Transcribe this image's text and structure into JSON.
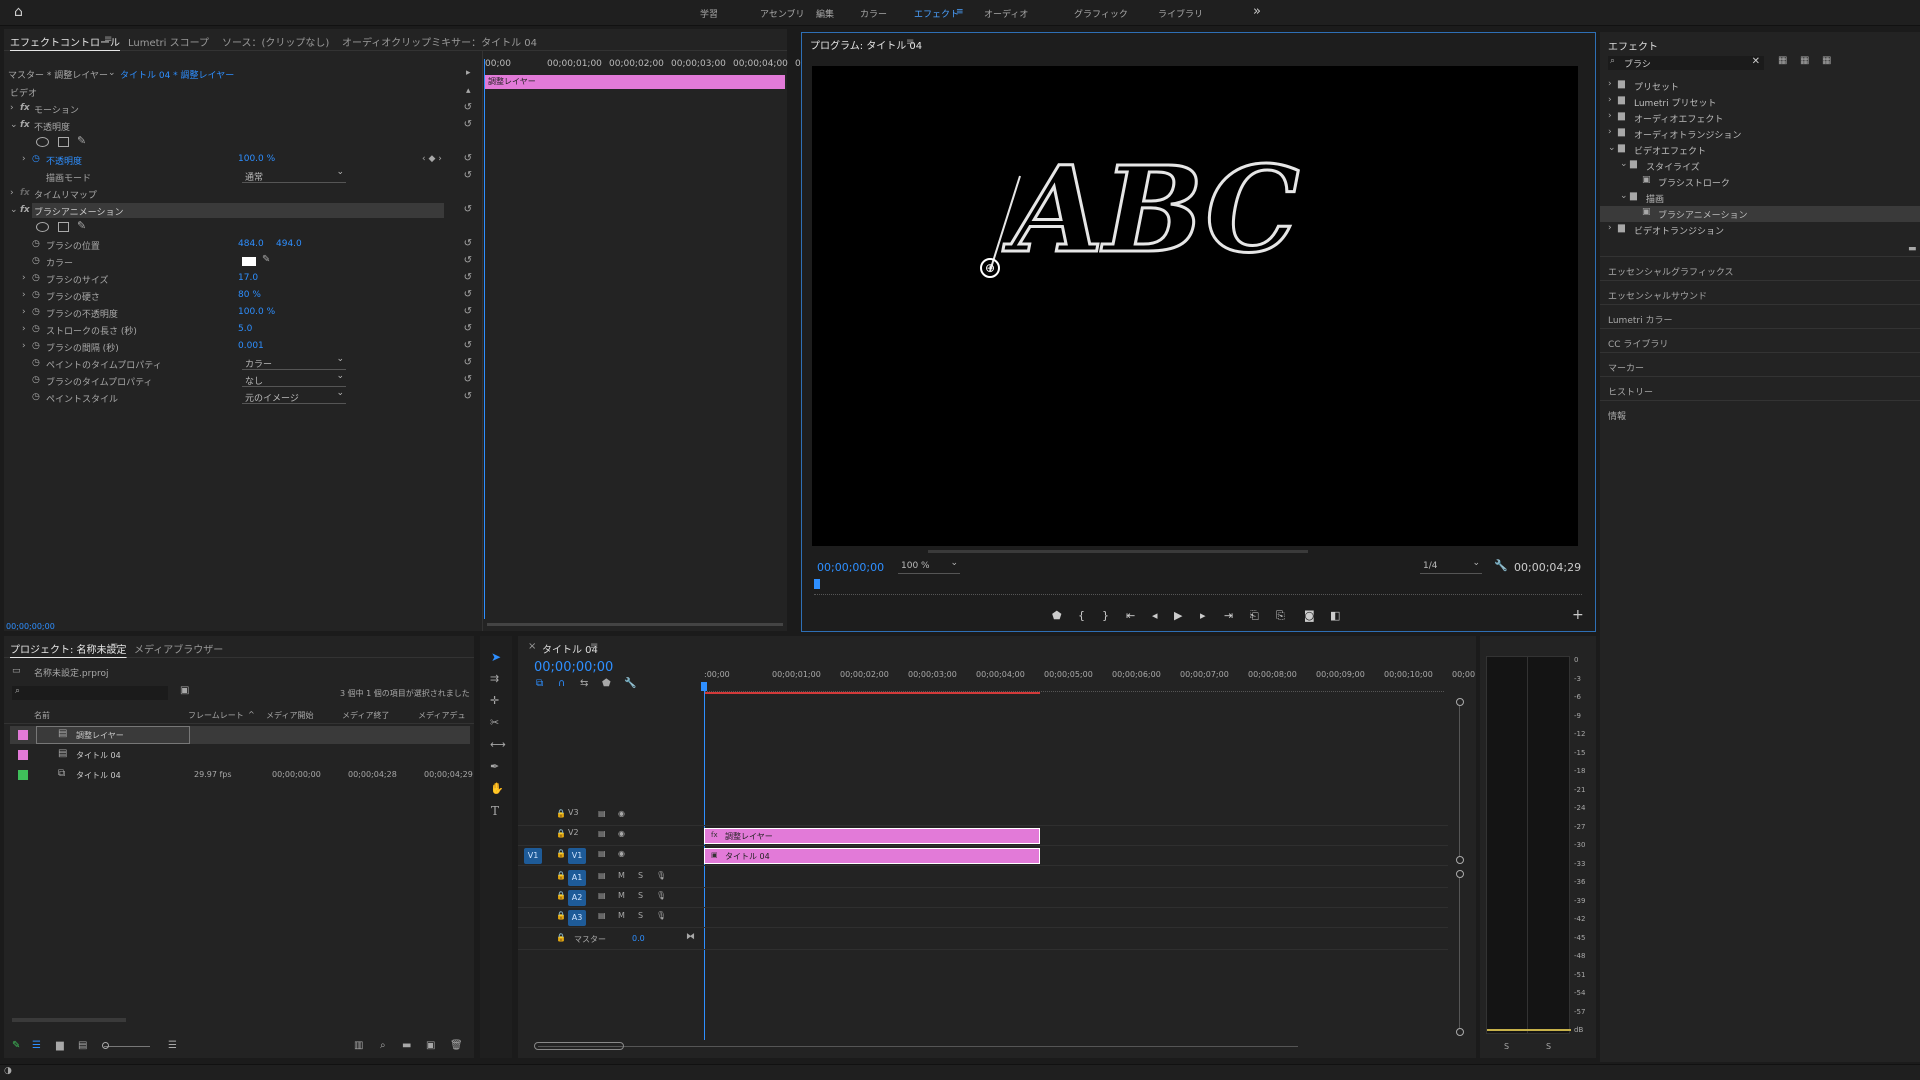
{
  "workspaces": {
    "items": [
      "学習",
      "アセンブリ",
      "編集",
      "カラー",
      "エフェクト",
      "オーディオ",
      "グラフィック",
      "ライブラリ"
    ],
    "active": "エフェクト",
    "overflow": "»"
  },
  "effect_controls": {
    "tabs": [
      "エフェクトコントロール",
      "Lumetri スコープ",
      "ソース：(クリップなし)",
      "オーディオクリップミキサー：タイトル 04"
    ],
    "master_label": "マスター * 調整レイヤー",
    "clip_label": "タイトル 04 * 調整レイヤー",
    "ruler": [
      "00;00",
      "00;00;01;00",
      "00;00;02;00",
      "00;00;03;00",
      "00;00;04;00",
      "00;00"
    ],
    "clip_bar_label": "調整レイヤー",
    "video_header": "ビデオ",
    "motion": "モーション",
    "opacity": "不透明度",
    "opacity_prop": "不透明度",
    "opacity_value": "100.0 %",
    "blend_mode_label": "描画モード",
    "blend_mode_value": "通常",
    "time_remap": "タイムリマップ",
    "brush_anim": "ブラシアニメーション",
    "props": [
      {
        "label": "ブラシの位置",
        "value": "484.0",
        "value2": "494.0"
      },
      {
        "label": "カラー",
        "value": ""
      },
      {
        "label": "ブラシのサイズ",
        "value": "17.0"
      },
      {
        "label": "ブラシの硬さ",
        "value": "80 %"
      },
      {
        "label": "ブラシの不透明度",
        "value": "100.0 %"
      },
      {
        "label": "ストロークの長さ (秒)",
        "value": "5.0"
      },
      {
        "label": "ブラシの間隔 (秒)",
        "value": "0.001"
      },
      {
        "label": "ペイントのタイムプロパティ",
        "dropdown": "カラー"
      },
      {
        "label": "ブラシのタイムプロパティ",
        "dropdown": "なし"
      },
      {
        "label": "ペイントスタイル",
        "dropdown": "元のイメージ"
      }
    ],
    "timecode": "00;00;00;00"
  },
  "program": {
    "title": "プログラム: タイトル 04",
    "overlay_text": "ABC",
    "timecode": "00;00;00;00",
    "zoom": "100 %",
    "resolution": "1/4",
    "duration": "00;00;04;29"
  },
  "effects_panel": {
    "title": "エフェクト",
    "search_value": "ブラシ",
    "tree": [
      {
        "label": "プリセット",
        "level": 0
      },
      {
        "label": "Lumetri プリセット",
        "level": 0
      },
      {
        "label": "オーディオエフェクト",
        "level": 0
      },
      {
        "label": "オーディオトランジション",
        "level": 0
      },
      {
        "label": "ビデオエフェクト",
        "level": 0
      },
      {
        "label": "スタイライズ",
        "level": 1
      },
      {
        "label": "ブラシストローク",
        "level": 2
      },
      {
        "label": "描画",
        "level": 1
      },
      {
        "label": "ブラシアニメーション",
        "level": 2
      },
      {
        "label": "ビデオトランジション",
        "level": 0
      }
    ],
    "sections": [
      "エッセンシャルグラフィックス",
      "エッセンシャルサウンド",
      "Lumetri カラー",
      "CC ライブラリ",
      "マーカー",
      "ヒストリー",
      "情報"
    ]
  },
  "project": {
    "tabs": [
      "プロジェクト: 名称未設定",
      "メディアブラウザー"
    ],
    "file": "名称未設定.prproj",
    "selection_info": "3 個中 1 個の項目が選択されました",
    "columns": [
      "名前",
      "フレームレート",
      "メディア開始",
      "メディア終了",
      "メディアデュ"
    ],
    "items": [
      {
        "name": "調整レイヤー",
        "fps": "",
        "start": "",
        "end": "",
        "dur": "",
        "color": "#e27ad8"
      },
      {
        "name": "タイトル 04",
        "fps": "",
        "start": "",
        "end": "",
        "dur": "",
        "color": "#e27ad8"
      },
      {
        "name": "タイトル 04",
        "fps": "29.97 fps",
        "start": "00;00;00;00",
        "end": "00;00;04;28",
        "dur": "00;00;04;29",
        "color": "#3fbf5a"
      }
    ]
  },
  "timeline": {
    "title": "タイトル 04",
    "timecode": "00;00;00;00",
    "ruler": [
      ":00;00",
      "00;00;01;00",
      "00;00;02;00",
      "00;00;03;00",
      "00;00;04;00",
      "00;00;05;00",
      "00;00;06;00",
      "00;00;07;00",
      "00;00;08;00",
      "00;00;09;00",
      "00;00;10;00",
      "00;00"
    ],
    "tracks": [
      "V3",
      "V2",
      "V1",
      "A1",
      "A2",
      "A3"
    ],
    "source_patch": "V1",
    "master_label": "マスター",
    "master_value": "0.0",
    "clips": [
      {
        "track": "V2",
        "label": "調整レイヤー",
        "badge": "fx"
      },
      {
        "track": "V1",
        "label": "タイトル 04",
        "badge": ""
      }
    ],
    "audio_m": "M",
    "audio_s": "S"
  },
  "meter": {
    "scale": [
      "0",
      "-3",
      "-6",
      "-9",
      "-12",
      "-15",
      "-18",
      "-21",
      "-24",
      "-27",
      "-30",
      "-33",
      "-36",
      "-39",
      "-42",
      "-45",
      "-48",
      "-51",
      "-54",
      "-57",
      "dB"
    ],
    "solo": [
      "S",
      "S"
    ]
  },
  "colors": {
    "accent": "#2e8fff",
    "clip": "#e27ad8",
    "playhead": "#2e8fff"
  }
}
